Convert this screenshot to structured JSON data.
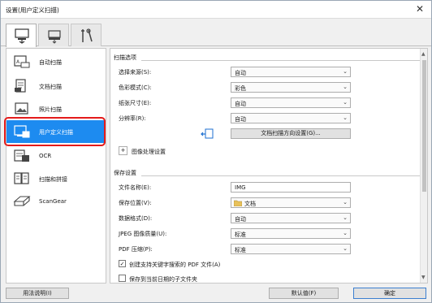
{
  "window": {
    "title": "设置(用户定义扫描)"
  },
  "tabs": [
    {
      "name": "scan-tab-icon"
    },
    {
      "name": "scanner-settings-tab-icon"
    },
    {
      "name": "general-settings-tab-icon"
    }
  ],
  "nav": {
    "items": [
      {
        "label": "自动扫描"
      },
      {
        "label": "文档扫描"
      },
      {
        "label": "照片扫描"
      },
      {
        "label": "用户定义扫描"
      },
      {
        "label": "OCR"
      },
      {
        "label": "扫描和拼接"
      },
      {
        "label": "ScanGear"
      }
    ],
    "selected": "用户定义扫描"
  },
  "scan_options": {
    "title": "扫描选项",
    "source_label": "选择来源(S):",
    "source_value": "自动",
    "color_label": "色彩模式(C):",
    "color_value": "彩色",
    "paper_label": "纸张尺寸(E):",
    "paper_value": "自动",
    "res_label": "分辨率(R):",
    "res_value": "自动",
    "orient_button": "文档扫描方向设置(G)...",
    "img_proc_label": "图像处理设置"
  },
  "save_settings": {
    "title": "保存设置",
    "filename_label": "文件名称(E):",
    "filename_value": "IMG",
    "saveloc_label": "保存位置(V):",
    "saveloc_value": "文档",
    "format_label": "数据格式(D):",
    "format_value": "自动",
    "jpeg_label": "JPEG 图像质量(U):",
    "jpeg_value": "标准",
    "pdf_label": "PDF 压缩(P):",
    "pdf_value": "标准",
    "keyword_pdf_label": "创建支持关键字搜索的 PDF 文件(A)",
    "keyword_pdf_checked": true,
    "subfolder_label": "保存到当前日期的子文件夹",
    "subfolder_checked": false
  },
  "footer": {
    "help_button": "用法说明(I)",
    "defaults_button": "默认值(F)",
    "ok_button": "确定"
  },
  "colors": {
    "selection": "#1d8bf0",
    "highlight_box": "#e41b1b"
  }
}
